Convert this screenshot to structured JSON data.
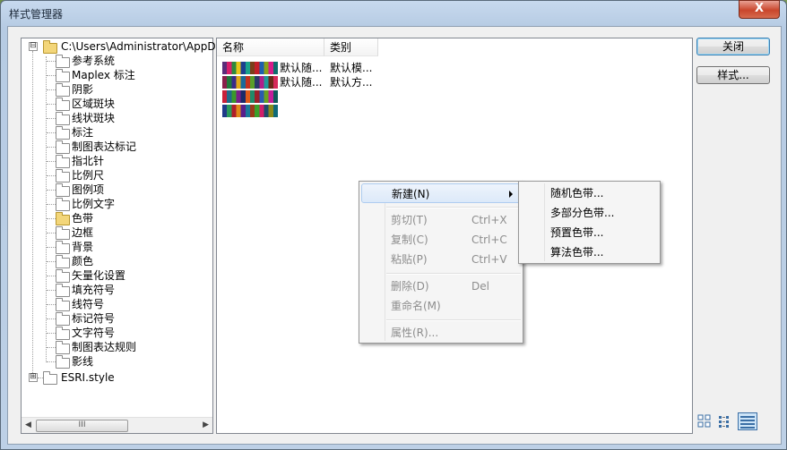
{
  "window": {
    "title": "样式管理器",
    "close_glyph": "X"
  },
  "tree": {
    "root": {
      "label": "C:\\Users\\Administrator\\AppData\\Ro",
      "expander": "⊟"
    },
    "children": [
      {
        "label": "参考系统"
      },
      {
        "label": "Maplex 标注"
      },
      {
        "label": "阴影"
      },
      {
        "label": "区域斑块"
      },
      {
        "label": "线状斑块"
      },
      {
        "label": "标注"
      },
      {
        "label": "制图表达标记"
      },
      {
        "label": "指北针"
      },
      {
        "label": "比例尺"
      },
      {
        "label": "图例项"
      },
      {
        "label": "比例文字"
      },
      {
        "label": "色带",
        "selected": true
      },
      {
        "label": "边框"
      },
      {
        "label": "背景"
      },
      {
        "label": "颜色"
      },
      {
        "label": "矢量化设置"
      },
      {
        "label": "填充符号"
      },
      {
        "label": "线符号"
      },
      {
        "label": "标记符号"
      },
      {
        "label": "文字符号"
      },
      {
        "label": "制图表达规则"
      },
      {
        "label": "影线"
      }
    ],
    "second_root": {
      "label": "ESRI.style",
      "expander": "⊞"
    },
    "scroll": {
      "left_arrow": "◀",
      "right_arrow": "▶",
      "thumb_grip": "III"
    }
  },
  "list": {
    "columns": [
      "名称",
      "类别"
    ],
    "rows": [
      {
        "name": "默认随...",
        "category": "默认模...",
        "swatch": [
          "#5a2d7a",
          "#d81f6a",
          "#2c8a3e",
          "#e8c51a",
          "#1d3f8f",
          "#1aa38a",
          "#7a3f1a",
          "#c21f2a",
          "#1f5fb0",
          "#8aa01a",
          "#d61e8a",
          "#0e6d6d"
        ]
      },
      {
        "name": "默认随...",
        "category": "默认方...",
        "swatch": [
          "#8a1f4a",
          "#1f7a3a",
          "#3a2a8a",
          "#e0a81a",
          "#1a6a9a",
          "#c2321f",
          "#5aa02a",
          "#2a3a6a",
          "#b01f8a",
          "#1f9a9a",
          "#6a2a1a",
          "#d62a5a"
        ]
      },
      {
        "name": "",
        "category": "",
        "swatch": [
          "#c81f3a",
          "#1f6a8a",
          "#3a9a2a",
          "#7a1f8a",
          "#1a2a6a",
          "#e05a1a",
          "#1f8a6a",
          "#9a1f2a",
          "#2a5ab0",
          "#6aa01f",
          "#c21f9a",
          "#0e5a5a"
        ]
      },
      {
        "name": "",
        "category": "",
        "swatch": [
          "#1f3a8a",
          "#2a9a5a",
          "#b01f2a",
          "#e08a1a",
          "#5a1f8a",
          "#1a7a9a",
          "#9a3a1a",
          "#3aa02a",
          "#d21f6a",
          "#1f4a6a",
          "#8a8a1a",
          "#0e6a7a"
        ]
      }
    ]
  },
  "buttons": {
    "close": "关闭",
    "styles": "样式..."
  },
  "context_menu": {
    "items": [
      {
        "label": "新建(N)",
        "shortcut": "",
        "disabled": false,
        "submenu": true
      },
      {
        "label": "剪切(T)",
        "shortcut": "Ctrl+X",
        "disabled": true
      },
      {
        "label": "复制(C)",
        "shortcut": "Ctrl+C",
        "disabled": true
      },
      {
        "label": "粘贴(P)",
        "shortcut": "Ctrl+V",
        "disabled": true
      },
      {
        "label": "删除(D)",
        "shortcut": "Del",
        "disabled": true
      },
      {
        "label": "重命名(M)",
        "shortcut": "",
        "disabled": true
      },
      {
        "label": "属性(R)...",
        "shortcut": "",
        "disabled": true
      }
    ]
  },
  "submenu": {
    "items": [
      "随机色带...",
      "多部分色带...",
      "预置色带...",
      "算法色带..."
    ]
  },
  "view_modes": [
    "large-icons-icon",
    "list-view-icon",
    "details-view-icon"
  ]
}
